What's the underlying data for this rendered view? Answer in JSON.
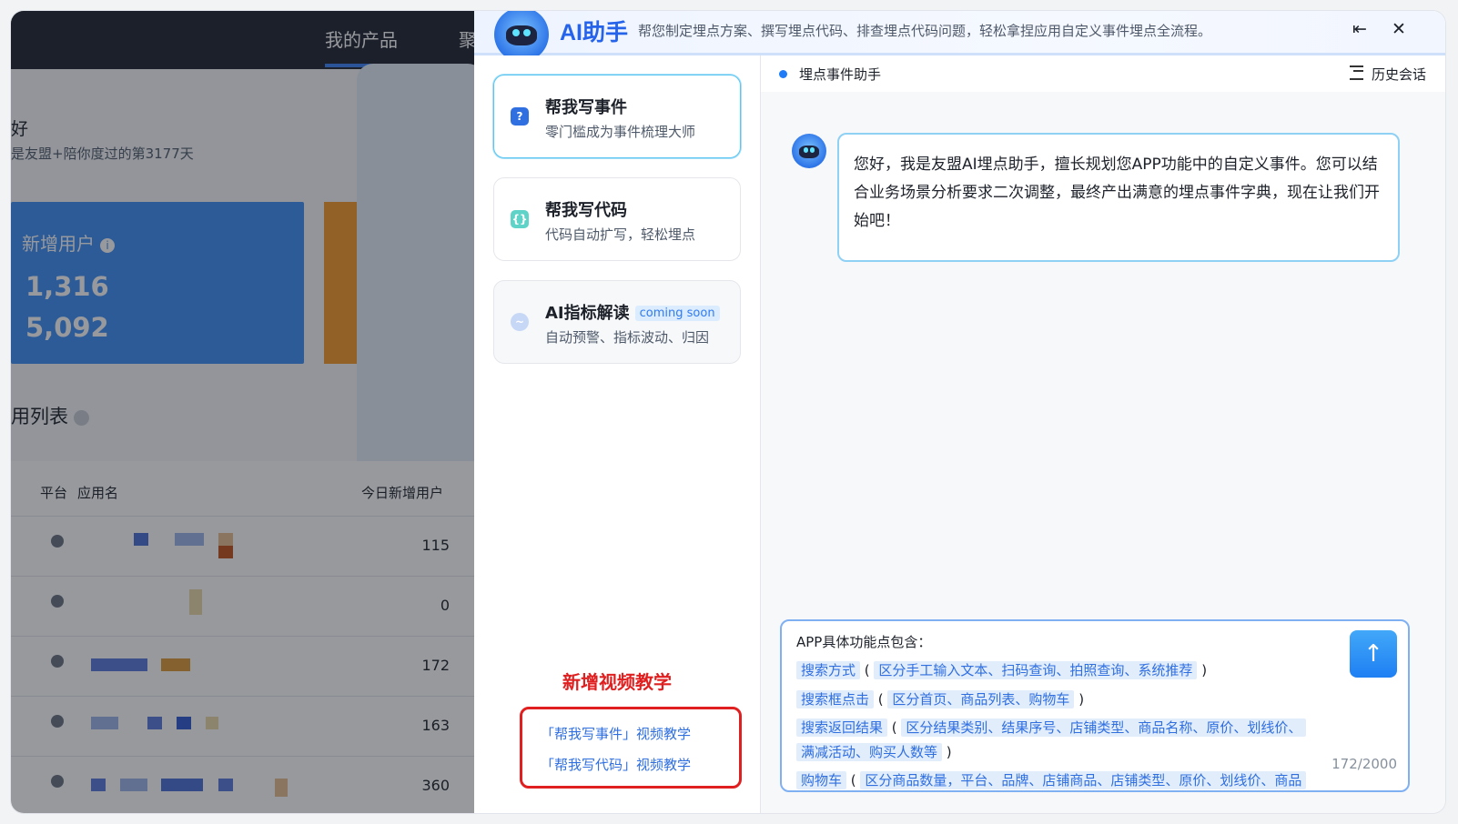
{
  "background_dashboard": {
    "nav_my_products": "我的产品",
    "nav_second": "聚",
    "greeting": "好",
    "days_text": "是友盟+陪你度过的第3177天",
    "new_users_label": "新增用户",
    "new_users_values": [
      "1,316",
      "5,092"
    ],
    "list_title": "用列表",
    "table_headers": {
      "platform": "平台",
      "app_name": "应用名",
      "new_users_today": "今日新增用户"
    },
    "table_values": [
      "115",
      "0",
      "172",
      "163",
      "360"
    ]
  },
  "ai_panel": {
    "title": "AI助手",
    "description": "帮您制定埋点方案、撰写埋点代码、排查埋点代码问题，轻松拿捏应用自定义事件埋点全流程。",
    "collapse_icon": "collapse-left-icon",
    "close_icon": "close-icon",
    "cards": [
      {
        "title": "帮我写事件",
        "subtitle": "零门槛成为事件梳理大师",
        "icon": "event-write-icon"
      },
      {
        "title": "帮我写代码",
        "subtitle": "代码自动扩写，轻松埋点",
        "icon": "code-write-icon"
      },
      {
        "title": "AI指标解读",
        "badge": "coming soon",
        "subtitle": "自动预警、指标波动、归因",
        "icon": "chart-trend-icon"
      }
    ],
    "promo_label": "新增视频教学",
    "video_links": [
      "「帮我写事件」视频教学",
      "「帮我写代码」视频教学"
    ],
    "assistant_name": "埋点事件助手",
    "history_label": "历史会话",
    "welcome_message": "您好，我是友盟AI埋点助手，擅长规划您APP功能中的自定义事件。您可以结合业务场景分析要求二次调整，最终产出满意的埋点事件字典，现在让我们开始吧！",
    "input": {
      "intro": "APP具体功能点包含：",
      "lines": [
        {
          "tag": "搜索方式",
          "detail": "区分手工输入文本、扫码查询、拍照查询、系统推荐"
        },
        {
          "tag": "搜索框点击",
          "detail": "区分首页、商品列表、购物车"
        },
        {
          "tag": "搜索返回结果",
          "detail": "区分结果类别、结果序号、店铺类型、商品名称、原价、划线价、"
        },
        {
          "detail": "满减活动、购买人数等"
        },
        {
          "tag": "购物车",
          "detail": "区分商品数量，平台、品牌、店铺商品、店铺类型、原价、划线价、商品"
        }
      ],
      "char_count": "172/2000",
      "send_icon": "arrow-up-icon"
    }
  },
  "colors": {
    "accent": "#2563eb",
    "promo_red": "#e02020",
    "tag_bg": "#e2edfc"
  }
}
